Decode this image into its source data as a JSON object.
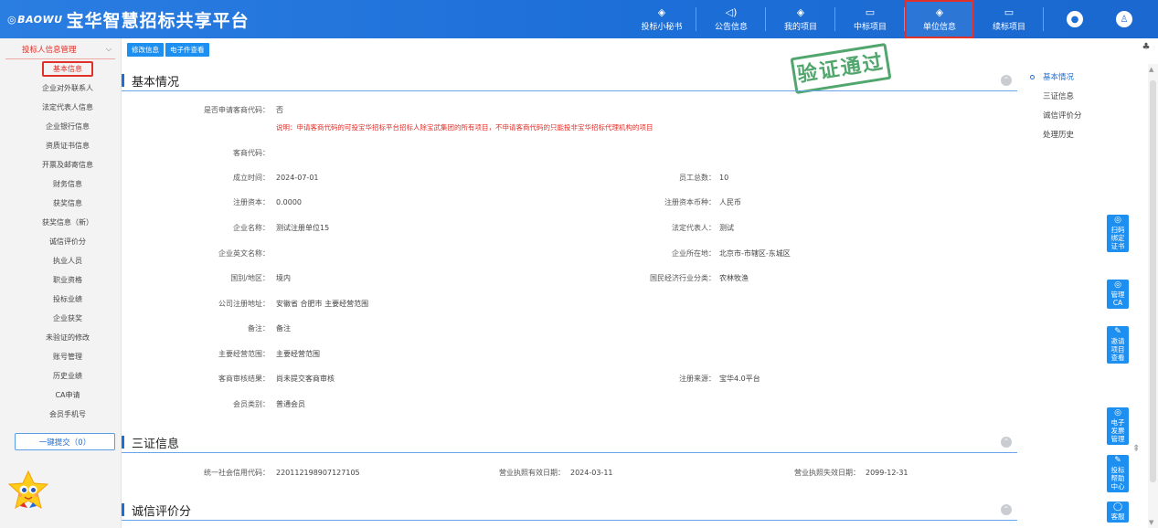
{
  "header": {
    "logo_mark": "BAOWU",
    "title": "宝华智慧招标共享平台",
    "nav": [
      {
        "label": "投标小秘书",
        "icon": "◈"
      },
      {
        "label": "公告信息",
        "icon": "◁)"
      },
      {
        "label": "我的项目",
        "icon": "◈"
      },
      {
        "label": "中标项目",
        "icon": "▭"
      },
      {
        "label": "单位信息",
        "icon": "◈"
      },
      {
        "label": "续标项目",
        "icon": "▭"
      }
    ],
    "active_nav": "单位信息"
  },
  "sidebar": {
    "group": "投标人信息管理",
    "items": [
      "基本信息",
      "企业对外联系人",
      "法定代表人信息",
      "企业银行信息",
      "资质证书信息",
      "开票及邮寄信息",
      "财务信息",
      "获奖信息",
      "获奖信息（新）",
      "诚信评价分",
      "执业人员",
      "职业资格",
      "投标业绩",
      "企业获奖",
      "未验证的修改",
      "账号管理",
      "历史业绩",
      "CA申请",
      "会员手机号"
    ],
    "active_item": "基本信息",
    "submit_button": "一键提交（0）"
  },
  "toolbar": {
    "edit": "修改信息",
    "docs": "电子件查看"
  },
  "stamp": "验证通过",
  "sections": {
    "basic": "基本情况",
    "cert": "三证信息",
    "credit": "诚信评价分"
  },
  "basic": {
    "apply_code_label": "是否申请客商代码：",
    "apply_code_value": "否",
    "note": "说明：申请客商代码的可投宝华招标平台招标人除宝武集团的所有项目，不申请客商代码的只能投非宝华招标代理机构的项目",
    "code_label": "客商代码：",
    "code_value": "",
    "found_label": "成立时间：",
    "found_value": "2024-07-01",
    "staff_label": "员工总数：",
    "staff_value": "10",
    "capital_label": "注册资本：",
    "capital_value": "0.0000",
    "currency_label": "注册资本币种：",
    "currency_value": "人民币",
    "name_label": "企业名称：",
    "name_value": "测试注册单位15",
    "legal_label": "法定代表人：",
    "legal_value": "测试",
    "en_name_label": "企业英文名称：",
    "en_name_value": "",
    "location_label": "企业所在地：",
    "location_value": "北京市-市辖区-东城区",
    "region_label": "国别/地区：",
    "region_value": "境内",
    "industry_label": "国民经济行业分类：",
    "industry_value": "农林牧渔",
    "address_label": "公司注册地址：",
    "address_value": "安徽省  合肥市  主要经营范围",
    "remark_label": "备注：",
    "remark_value": "备注",
    "scope_label": "主要经营范围：",
    "scope_value": "主要经营范围",
    "audit_label": "客商审核结果：",
    "audit_value": "尚未提交客商审核",
    "source_label": "注册来源：",
    "source_value": "宝华4.0平台",
    "member_label": "会员类别：",
    "member_value": "普通会员"
  },
  "cert": {
    "credit_code_label": "统一社会信用代码：",
    "credit_code_value": "220112198907127105",
    "valid_label": "营业执照有效日期：",
    "valid_value": "2024-03-11",
    "expire_label": "营业执照失效日期：",
    "expire_value": "2099-12-31"
  },
  "anchor_nav": [
    "基本情况",
    "三证信息",
    "诚信评价分",
    "处理历史"
  ],
  "float_tools": [
    {
      "label": "扫码绑定证书",
      "icon": "◎"
    },
    {
      "label": "管理CA",
      "icon": "◎"
    },
    {
      "label": "邀请项目查看",
      "icon": "✎"
    },
    {
      "label": "电子发票管理",
      "icon": "◎"
    },
    {
      "label": "投标帮助中心",
      "icon": "✎"
    },
    {
      "label": "客服",
      "icon": "◯"
    }
  ]
}
